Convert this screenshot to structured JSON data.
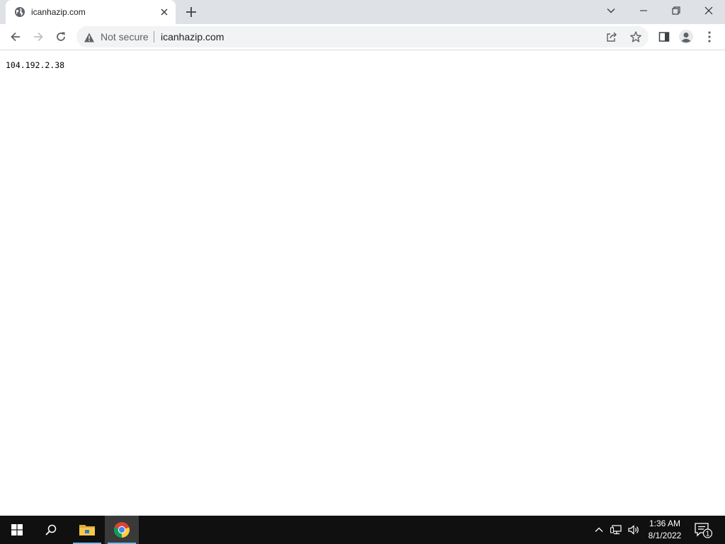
{
  "browser": {
    "tab": {
      "title": "icanhazip.com",
      "favicon": "globe-icon",
      "close_icon": "close-icon"
    },
    "new_tab_icon": "plus-icon",
    "window_controls": [
      "chevron-down-icon",
      "minimize-icon",
      "restore-icon",
      "close-icon"
    ],
    "toolbar": {
      "back_icon": "arrow-left-icon",
      "forward_icon": "arrow-right-icon",
      "reload_icon": "reload-icon",
      "security_label": "Not secure",
      "url": "icanhazip.com",
      "right_icons": [
        "share-icon",
        "star-icon",
        "side-panel-icon",
        "profile-icon",
        "more-vert-icon"
      ]
    }
  },
  "page": {
    "body_text": "104.192.2.38"
  },
  "taskbar": {
    "pinned": [
      "windows-start-icon",
      "search-icon",
      "file-explorer-icon",
      "chrome-icon"
    ],
    "tray_icons": [
      "chevron-up-icon",
      "network-icon",
      "volume-icon"
    ],
    "clock": {
      "time": "1:36 AM",
      "date": "8/1/2022"
    },
    "notification_count": "1"
  },
  "colors": {
    "tab_strip": "#dee1e6",
    "omnibox": "#f1f3f4",
    "taskbar": "#101010",
    "taskbar_active": "#76b9ed"
  }
}
